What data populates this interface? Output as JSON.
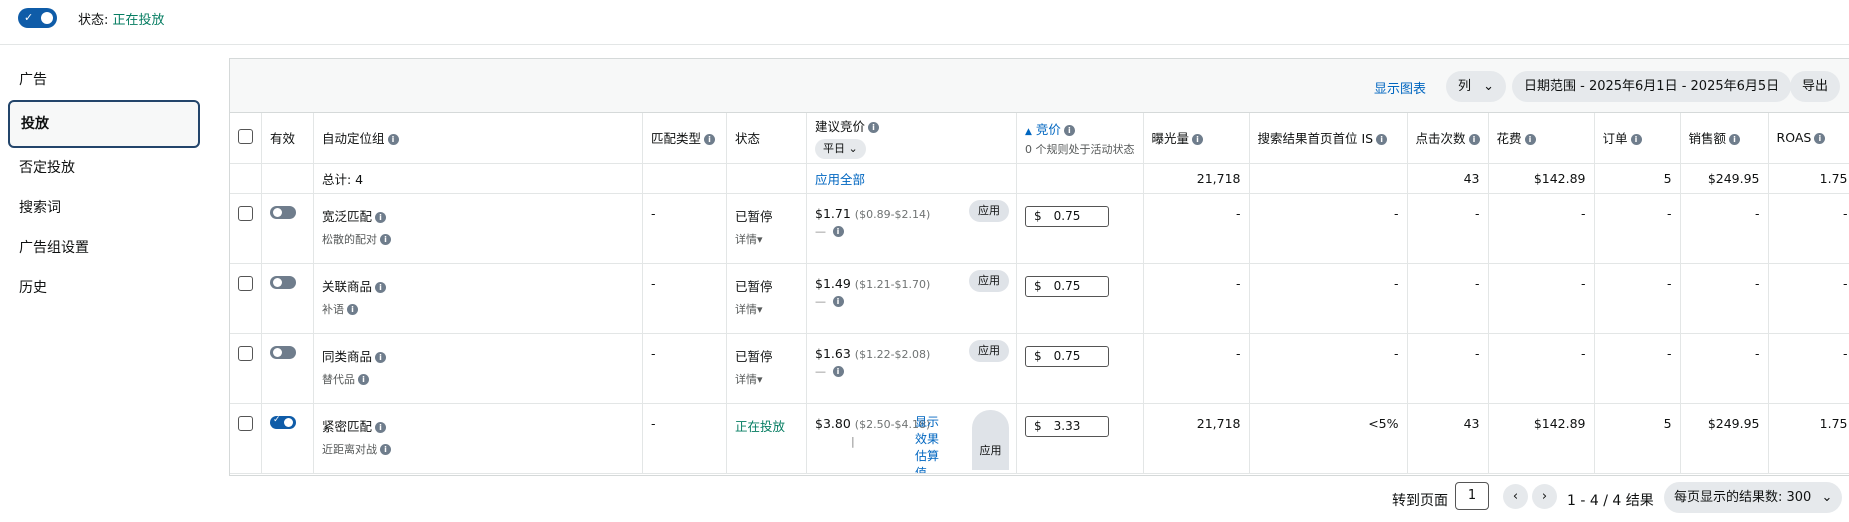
{
  "status": {
    "label": "状态:",
    "value": "正在投放"
  },
  "sidebar": {
    "items": [
      {
        "label": "广告"
      },
      {
        "label": "投放"
      },
      {
        "label": "否定投放"
      },
      {
        "label": "搜索词"
      },
      {
        "label": "广告组设置"
      },
      {
        "label": "历史"
      }
    ]
  },
  "toolbar": {
    "show_chart": "显示图表",
    "columns": "列",
    "date_range": "日期范围 - 2025年6月1日 - 2025年6月5日",
    "export": "导出"
  },
  "table": {
    "headers": {
      "active": "有效",
      "group": "自动定位组",
      "match_type": "匹配类型",
      "status": "状态",
      "suggested_bid": "建议竞价",
      "suggested_bid_pill": "平日",
      "bid": "竞价",
      "bid_sub": "0 个规则处于活动状态",
      "impressions": "曝光量",
      "top_of_search": "搜索结果首页首位 IS",
      "clicks": "点击次数",
      "spend": "花费",
      "orders": "订单",
      "sales": "销售额",
      "roas": "ROAS"
    },
    "total": {
      "label": "总计: 4",
      "apply_all": "应用全部",
      "impressions": "21,718",
      "clicks": "43",
      "spend": "$142.89",
      "orders": "5",
      "sales": "$249.95",
      "roas": "1.75"
    },
    "rows": [
      {
        "active": false,
        "name": "宽泛匹配",
        "sub": "松散的配对",
        "match": "-",
        "status": "已暂停",
        "detail": "详情",
        "sug_bid": "$1.71",
        "sug_range": "($0.89-$2.14)",
        "sug_note": "—",
        "apply": "应用",
        "currency": "$",
        "bid": "0.75",
        "impressions": "-",
        "top_is": "-",
        "clicks": "-",
        "spend": "-",
        "orders": "-",
        "sales": "-",
        "roas": "-"
      },
      {
        "active": false,
        "name": "关联商品",
        "sub": "补语",
        "match": "-",
        "status": "已暂停",
        "detail": "详情",
        "sug_bid": "$1.49",
        "sug_range": "($1.21-$1.70)",
        "sug_note": "—",
        "apply": "应用",
        "currency": "$",
        "bid": "0.75",
        "impressions": "-",
        "top_is": "-",
        "clicks": "-",
        "spend": "-",
        "orders": "-",
        "sales": "-",
        "roas": "-"
      },
      {
        "active": false,
        "name": "同类商品",
        "sub": "替代品",
        "match": "-",
        "status": "已暂停",
        "detail": "详情",
        "sug_bid": "$1.63",
        "sug_range": "($1.22-$2.08)",
        "sug_note": "—",
        "apply": "应用",
        "currency": "$",
        "bid": "0.75",
        "impressions": "-",
        "top_is": "-",
        "clicks": "-",
        "spend": "-",
        "orders": "-",
        "sales": "-",
        "roas": "-"
      },
      {
        "active": true,
        "name": "紧密匹配",
        "sub": "近距离对战",
        "match": "-",
        "status": "正在投放",
        "detail": "",
        "sug_bid": "$3.80",
        "sug_range": "($2.50-$4.18)",
        "sug_note": "|",
        "effect_link": "显示效果估算值",
        "apply": "应用",
        "currency": "$",
        "bid": "3.33",
        "impressions": "21,718",
        "top_is": "<5%",
        "clicks": "43",
        "spend": "$142.89",
        "orders": "5",
        "sales": "$249.95",
        "roas": "1.75"
      }
    ]
  },
  "pager": {
    "goto_label": "转到页面",
    "page": "1",
    "range": "1 - 4 / 4 结果",
    "per_page": "每页显示的结果数: 300"
  }
}
